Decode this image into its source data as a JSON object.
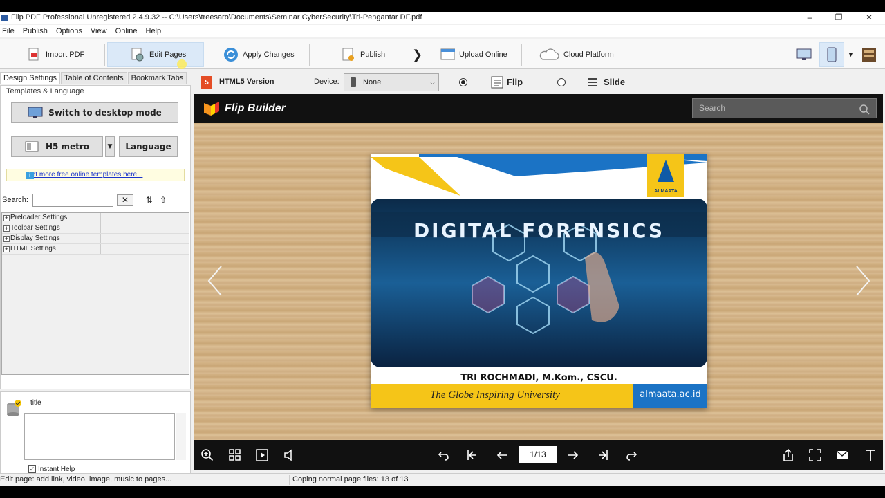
{
  "titlebar": {
    "title": "Flip PDF Professional Unregistered 2.4.9.32 -- C:\\Users\\treesaro\\Documents\\Seminar CyberSecurity\\Tri-Pengantar DF.pdf"
  },
  "menu": [
    "File",
    "Publish",
    "Options",
    "View",
    "Online",
    "Help"
  ],
  "toolbar": {
    "import": "Import PDF",
    "edit": "Edit Pages",
    "apply": "Apply Changes",
    "publish": "Publish",
    "upload": "Upload Online",
    "cloud": "Cloud Platform"
  },
  "left": {
    "tabs": [
      "Design Settings",
      "Table of Contents",
      "Bookmark Tabs"
    ],
    "group": "Templates & Language",
    "desktop_btn": "Switch to desktop mode",
    "template": "H5 metro",
    "language": "Language",
    "link": "Get more free online templates here...",
    "search_label": "Search:",
    "tree": [
      "Preloader Settings",
      "Toolbar Settings",
      "Display Settings",
      "HTML Settings"
    ],
    "prop_title": "title",
    "instant_help": "Instant Help"
  },
  "viewer": {
    "html5": "HTML5 Version",
    "device_label": "Device:",
    "device_value": "None",
    "mode_flip": "Flip",
    "mode_slide": "Slide"
  },
  "flip": {
    "brand": "Flip Builder",
    "search_placeholder": "Search",
    "page_indicator": "1/13",
    "cover_heading": "DIGITAL FORENSICS",
    "author": "TRI ROCHMADI, M.Kom., CSCU.",
    "tagline": "The Globe Inspiring University",
    "site": "almaata.ac.id",
    "logo_text": "ALMAATA"
  },
  "status": {
    "left": "Edit page: add link, video, image, music to pages...",
    "right": "Coping normal page files: 13 of 13"
  }
}
